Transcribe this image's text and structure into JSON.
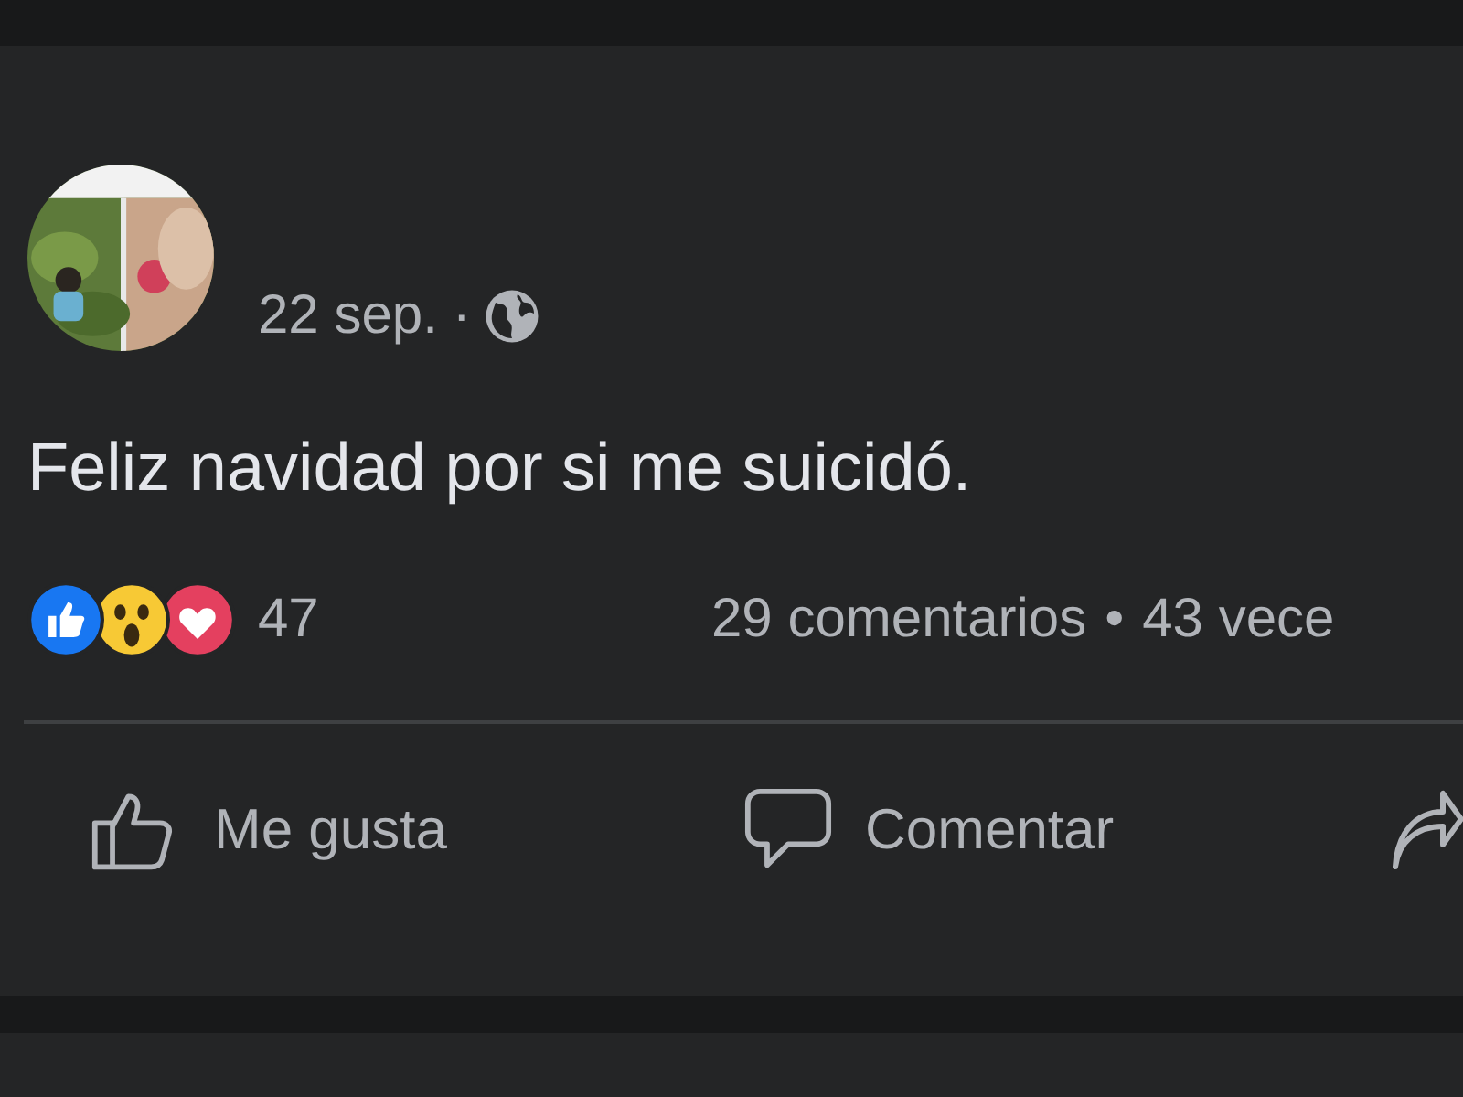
{
  "post": {
    "date": "22 sep.",
    "separator": "·",
    "audience": {
      "kind": "public"
    },
    "text": "Feliz navidad por si me suicidó.",
    "reactions": {
      "types": [
        {
          "kind": "like"
        },
        {
          "kind": "wow"
        },
        {
          "kind": "love"
        }
      ],
      "count": "47"
    },
    "stats": [
      "29 comentarios",
      "•",
      "43 vece"
    ],
    "actions": [
      {
        "kind": "like",
        "label": "Me gusta"
      },
      {
        "kind": "comment",
        "label": "Comentar"
      },
      {
        "kind": "share"
      }
    ]
  }
}
